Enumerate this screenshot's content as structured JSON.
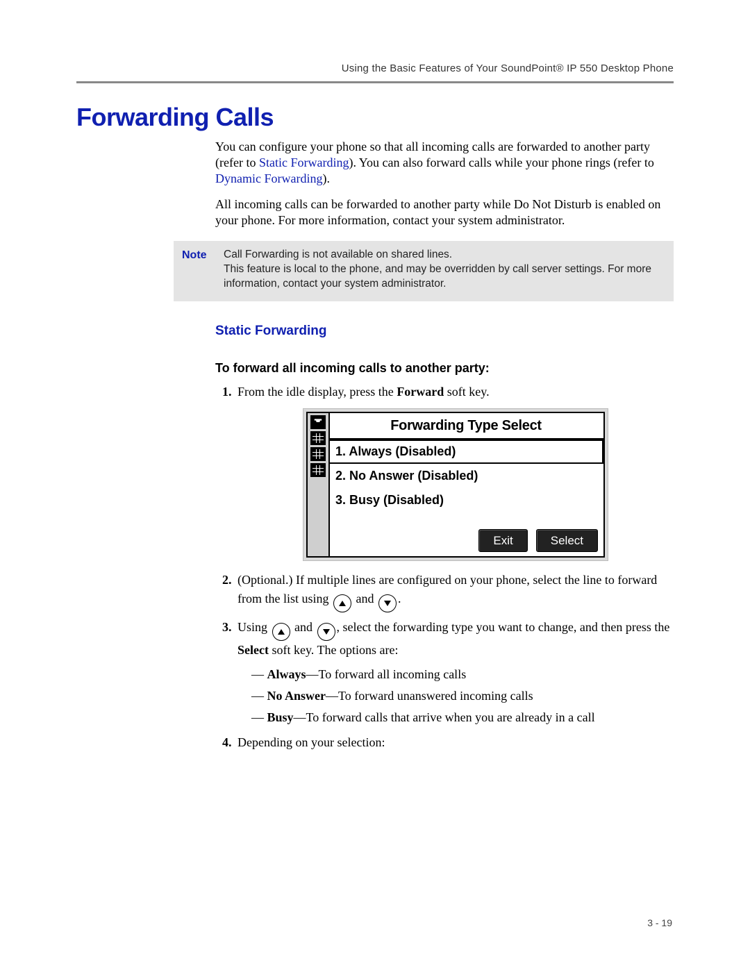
{
  "header": {
    "running": "Using the Basic Features of Your SoundPoint® IP 550 Desktop Phone"
  },
  "title": "Forwarding Calls",
  "intro": {
    "p1a": "You can configure your phone so that all incoming calls are forwarded to another party (refer to ",
    "link1": "Static Forwarding",
    "p1b": "). You can also forward calls while your phone rings (refer to ",
    "link2": "Dynamic Forwarding",
    "p1c": ").",
    "p2": "All incoming calls can be forwarded to another party while Do Not Disturb is enabled on your phone. For more information, contact your system administrator."
  },
  "note": {
    "label": "Note",
    "line1": "Call Forwarding is not available on shared lines.",
    "line2": "This feature is local to the phone, and may be overridden by call server settings. For more information, contact your system administrator."
  },
  "static_heading": "Static Forwarding",
  "proc_heading": "To forward all incoming calls to another party:",
  "steps": {
    "s1a": "From the idle display, press the ",
    "s1_bold": "Forward",
    "s1b": " soft key.",
    "s2a": "(Optional.) If multiple lines are configured on your phone, select the line to forward from the list using ",
    "s2_and": " and ",
    "s2b": ".",
    "s3a": "Using ",
    "s3_and": " and ",
    "s3b": ", select the forwarding type you want to change, and then press the ",
    "s3_bold": "Select",
    "s3c": " soft key. The options are:",
    "opt1_bold": "Always",
    "opt1_rest": "—To forward all incoming calls",
    "opt2_bold": "No Answer",
    "opt2_rest": "—To forward unanswered incoming calls",
    "opt3_bold": "Busy",
    "opt3_rest": "—To forward calls that arrive when you are already in a call",
    "s4": "Depending on your selection:"
  },
  "lcd": {
    "title": "Forwarding Type Select",
    "items": [
      "1. Always (Disabled)",
      "2. No Answer (Disabled)",
      "3. Busy (Disabled)"
    ],
    "soft_exit": "Exit",
    "soft_select": "Select"
  },
  "footer": {
    "page": "3 - 19"
  }
}
